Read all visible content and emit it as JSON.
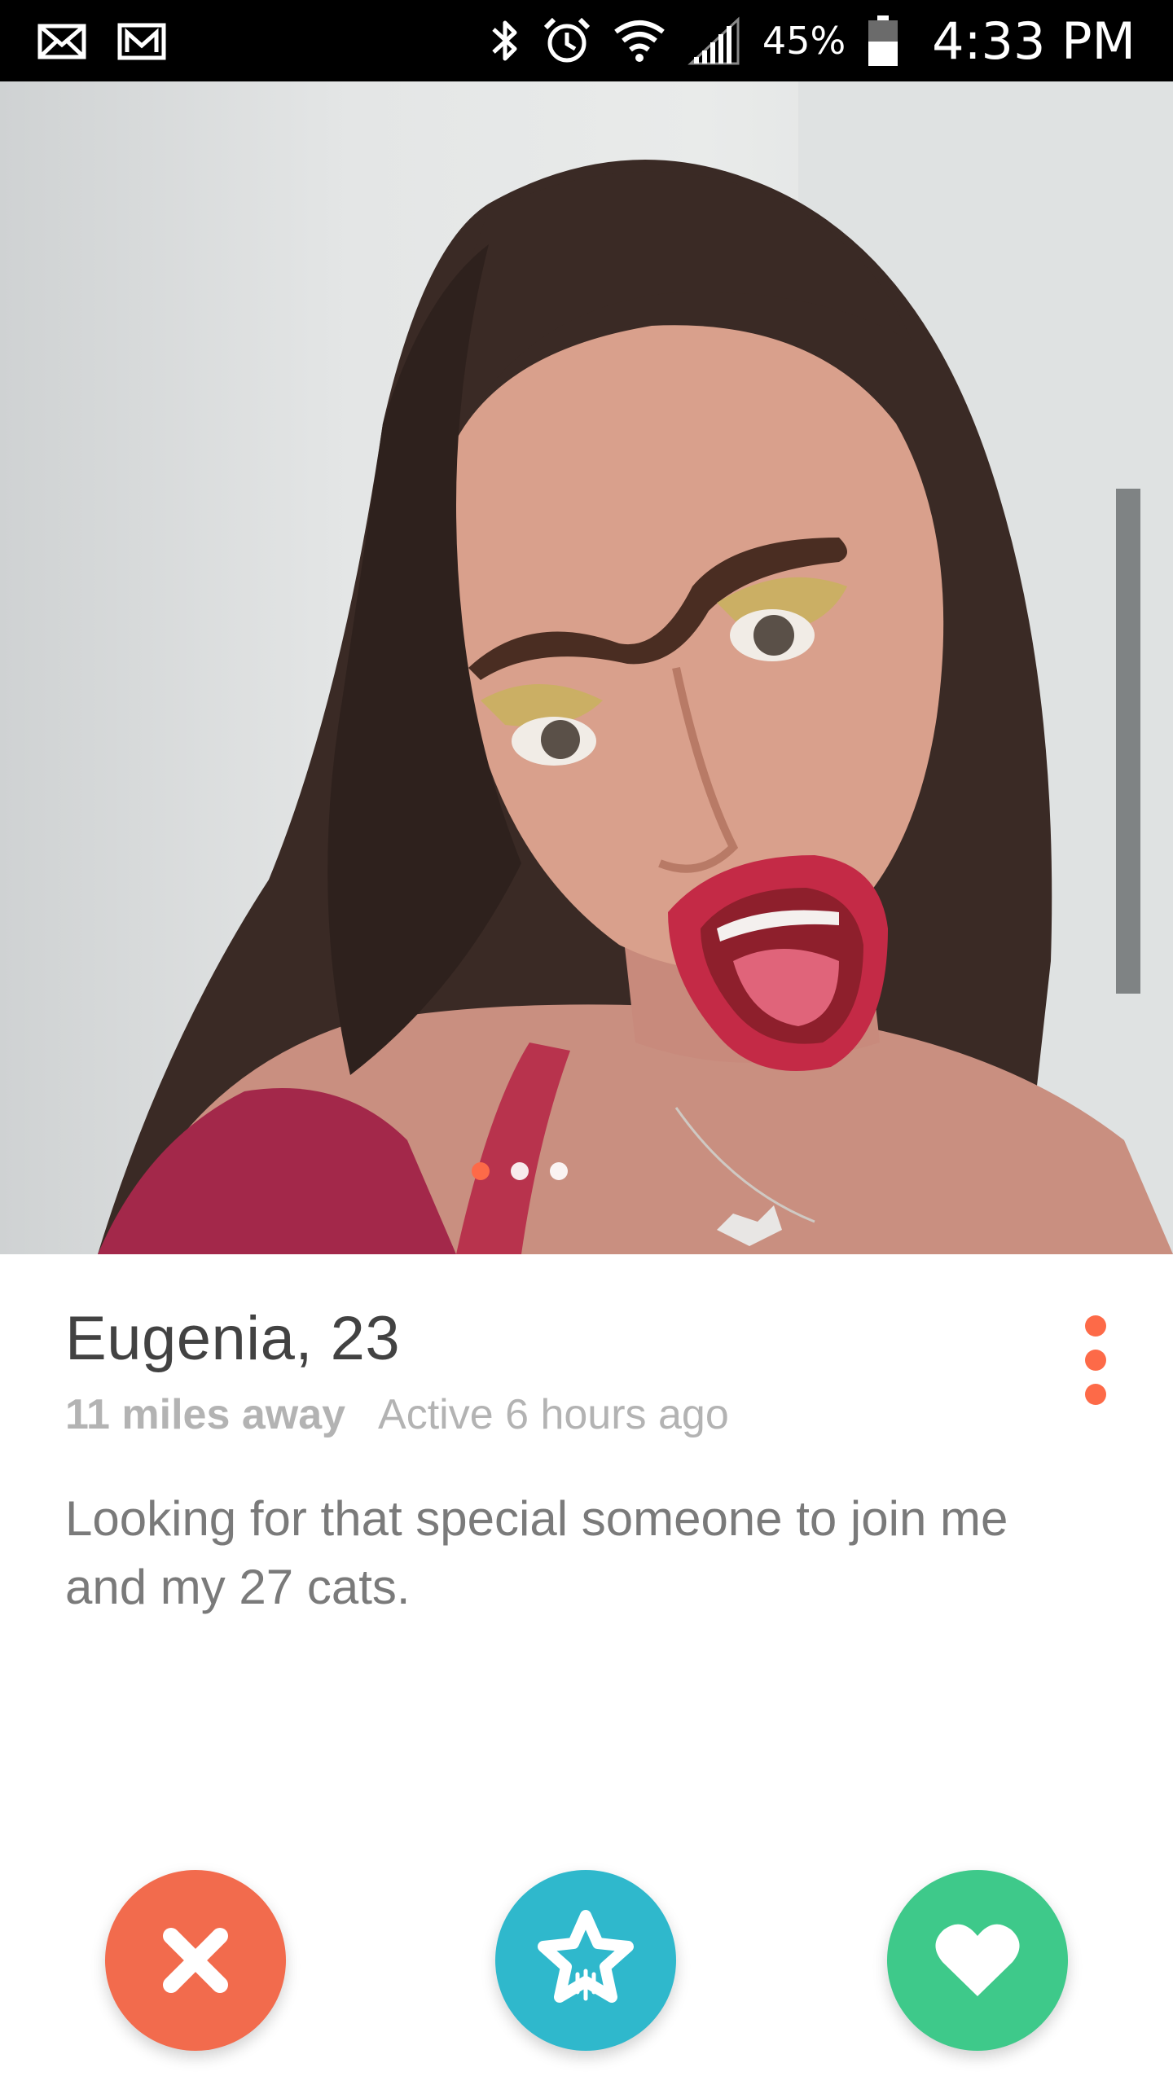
{
  "status_bar": {
    "left_icons": [
      "mail-icon",
      "gmail-icon"
    ],
    "right_icons": [
      "bluetooth-icon",
      "alarm-icon",
      "wifi-icon",
      "signal-icon",
      "battery-icon"
    ],
    "battery_percent": "45%",
    "time": "4:33 PM"
  },
  "photo": {
    "page_count": 3,
    "active_index": 0
  },
  "profile": {
    "name_age": "Eugenia, 23",
    "distance": "11 miles away",
    "activity": "Active 6 hours ago",
    "bio": "Looking for that special someone to join me and my 27 cats."
  },
  "actions": {
    "nope_icon": "close-icon",
    "superlike_icon": "star-icon",
    "like_icon": "heart-icon"
  },
  "colors": {
    "accent": "#fd6a48",
    "nope": "#f26b4d",
    "superlike": "#2fb8cc",
    "like": "#3ec98a"
  }
}
